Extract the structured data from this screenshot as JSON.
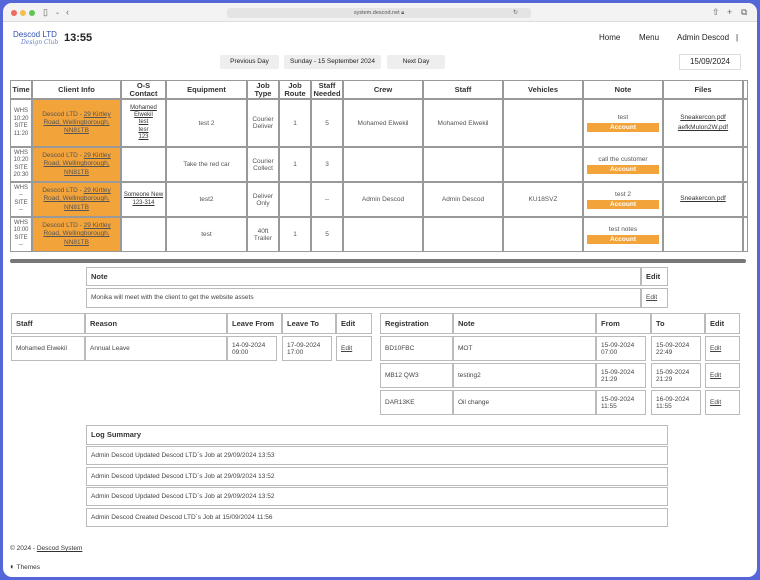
{
  "browser": {
    "url": "system.descod.net"
  },
  "header": {
    "logo_line1": "Descod LTD",
    "logo_line2": "Design Club",
    "clock": "13:55",
    "nav_home": "Home",
    "nav_menu": "Menu",
    "user": "Admin Descod",
    "user_sep": "|"
  },
  "datebar": {
    "prev": "Previous Day",
    "range": "Sunday - 15 September 2024",
    "next": "Next Day",
    "date": "15/09/2024"
  },
  "schedule": {
    "headers": [
      "Time",
      "Client Info",
      "O-S Contact",
      "Equipment",
      "Job Type",
      "Job Route",
      "Staff Needed",
      "Crew",
      "Staff",
      "Vehicles",
      "Note",
      "Files"
    ],
    "rows": [
      {
        "time": [
          "WHS",
          "10:20",
          "SITE",
          "11:20"
        ],
        "client": "Descod LTD - ",
        "client_link": "29 Kirtley Road, Wellingborough, NN81TB",
        "contact": [
          "Mohamed Elwekil",
          "test",
          "tesr",
          "123"
        ],
        "equipment": "test 2",
        "job_type": "Courier Deliver",
        "route": "1",
        "needed": "5",
        "crew": "Mohamed Elwekil",
        "staff": "Mohamed Elwekil",
        "vehicles": "",
        "note": "test",
        "account": "Account",
        "files": [
          "Sneakercon.pdf",
          "aefkMulon2W.pdf"
        ]
      },
      {
        "time": [
          "WHS",
          "10:20",
          "SITE",
          "20:30"
        ],
        "client": "Descod LTD - ",
        "client_link": "29 Kirtley Road, Wellingborough, NN81TB",
        "contact": [],
        "equipment": "Take the red car",
        "job_type": "Courier Collect",
        "route": "1",
        "needed": "3",
        "crew": "",
        "staff": "",
        "vehicles": "",
        "note": "call the customer",
        "account": "Account",
        "files": []
      },
      {
        "time": [
          "WHS",
          "--",
          "SITE",
          "--"
        ],
        "client": "Descod LTD - ",
        "client_link": "29 Kirtley Road, Wellingborough, NN81TB",
        "contact": [
          "Someone New",
          "123-314"
        ],
        "equipment": "test2",
        "job_type": "Deliver Only",
        "route": "",
        "needed": "--",
        "crew": "Admin Descod",
        "staff": "Admin Descod",
        "vehicles": "KU18SVZ",
        "note": "test 2",
        "account": "Account",
        "files": [
          "Sneakercon.pdf"
        ]
      },
      {
        "time": [
          "WHS",
          "10:00",
          "SITE",
          "--"
        ],
        "client": "Descod LTD - ",
        "client_link": "29 Kirtley Road, Wellingborough, NN81TB",
        "contact": [],
        "equipment": "test",
        "job_type": "40ft Trailer",
        "route": "1",
        "needed": "5",
        "crew": "",
        "staff": "",
        "vehicles": "",
        "note": "test notes",
        "account": "Account",
        "files": []
      }
    ]
  },
  "note_panel": {
    "header": "Note",
    "edit_header": "Edit",
    "text": "Monika will meet with the client to get the website assets",
    "edit": "Edit"
  },
  "leave": {
    "headers": [
      "Staff",
      "Reason",
      "Leave From",
      "Leave To",
      "Edit"
    ],
    "rows": [
      {
        "staff": "Mohamed Elwekil",
        "reason": "Annual Leave",
        "from": "14-09-2024 09:00",
        "to": "17-09-2024 17:00",
        "edit": "Edit"
      }
    ]
  },
  "vehicle_notes": {
    "headers": [
      "Registration",
      "Note",
      "From",
      "To",
      "Edit"
    ],
    "rows": [
      {
        "reg": "BD10FBC",
        "note": "MOT",
        "from": "15-09-2024 07:00",
        "to": "15-09-2024 22:49",
        "edit": "Edit"
      },
      {
        "reg": "MB12 QW3",
        "note": "testing2",
        "from": "15-09-2024 21:29",
        "to": "15-09-2024 21:29",
        "edit": "Edit"
      },
      {
        "reg": "DAR13KE",
        "note": "Oil change",
        "from": "15-09-2024 11:55",
        "to": "16-09-2024 11:55",
        "edit": "Edit"
      }
    ]
  },
  "log": {
    "title": "Log Summary",
    "entries": [
      "Admin Descod Updated Descod LTD`s Job at 29/09/2024 13:53",
      "Admin Descod Updated Descod LTD`s Job at 29/09/2024 13:52",
      "Admin Descod Updated Descod LTD`s Job at 29/09/2024 13:52",
      "Admin Descod Created Descod LTD`s Job at 15/09/2024 11:56"
    ]
  },
  "footer": {
    "copyright": "© 2024 - ",
    "system_link": "Descod System",
    "themes": "Themes"
  },
  "colors": {
    "accent": "#f2a33a",
    "frame": "#5566d9"
  }
}
